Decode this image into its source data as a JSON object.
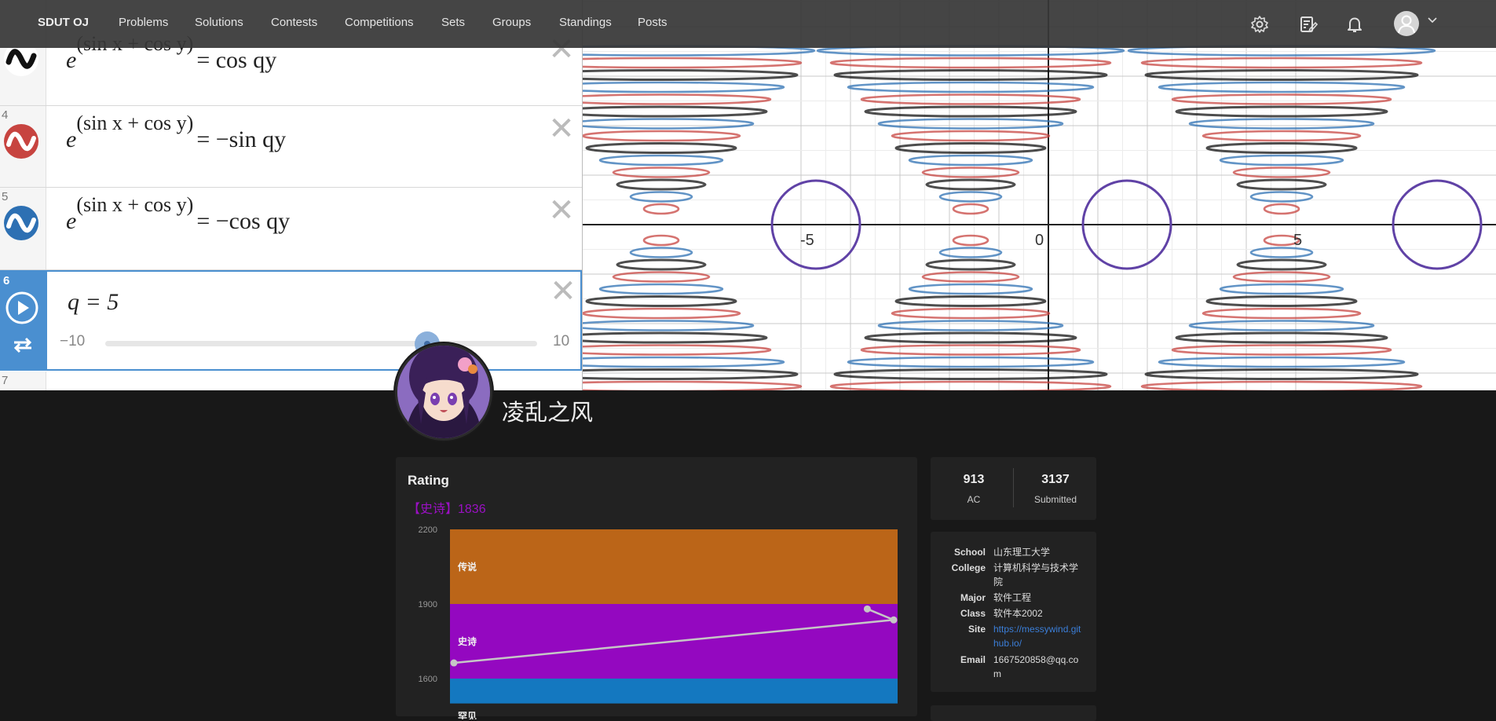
{
  "navbar": {
    "brand": "SDUT OJ",
    "items": [
      "Problems",
      "Solutions",
      "Contests",
      "Competitions",
      "Sets",
      "Groups",
      "Standings",
      "Posts"
    ]
  },
  "banner": {
    "expressions": [
      {
        "number": "",
        "lhs": "e",
        "exponent": "(sin x + cos y)",
        "rhs": "= cos qy",
        "icon_color": "#111111"
      },
      {
        "number": "4",
        "lhs": "e",
        "exponent": "(sin x + cos y)",
        "rhs": "= −sin qy",
        "icon_color": "#c74440"
      },
      {
        "number": "5",
        "lhs": "e",
        "exponent": "(sin x + cos y)",
        "rhs": "= −cos qy",
        "icon_color": "#2d70b3"
      }
    ],
    "slider": {
      "number": "6",
      "label": "q = 5",
      "min": "−10",
      "max": "10",
      "value": 5
    },
    "next_row_number": "7",
    "graph_ticks": [
      "-5",
      "0",
      "5"
    ],
    "colors": {
      "red": "#c74440",
      "blue": "#2d70b3",
      "black": "#111111",
      "purple": "#6042a6"
    }
  },
  "profile": {
    "username": "凌乱之风"
  },
  "rating": {
    "title": "Rating",
    "current": "【史诗】1836",
    "y_ticks": [
      "2200",
      "1900",
      "1600"
    ],
    "bands": [
      {
        "name": "传说",
        "color": "#bb6518"
      },
      {
        "name": "史诗",
        "color": "#9408c0"
      },
      {
        "name": "罕见",
        "color": "#1478c0"
      }
    ]
  },
  "chart_data": {
    "type": "line",
    "title": "Rating",
    "y_range": [
      1500,
      2200
    ],
    "bands": [
      {
        "label": "传说",
        "from": 1900,
        "to": 2200,
        "color": "#bb6518"
      },
      {
        "label": "史诗",
        "from": 1600,
        "to": 1900,
        "color": "#9408c0"
      },
      {
        "label": "罕见",
        "from": 1500,
        "to": 1600,
        "color": "#1478c0"
      }
    ],
    "series": [
      {
        "values": [
          1663,
          1836,
          1880
        ],
        "order": [
          0,
          2,
          1
        ]
      }
    ],
    "points": [
      {
        "x": 0,
        "y": 1663
      },
      {
        "x": 1,
        "y": 1836
      },
      {
        "x": 0.94,
        "y": 1880
      }
    ]
  },
  "stats": {
    "ac_value": "913",
    "ac_label": "AC",
    "submitted_value": "3137",
    "submitted_label": "Submitted"
  },
  "info": {
    "school_label": "School",
    "school": "山东理工大学",
    "college_label": "College",
    "college": "计算机科学与技术学院",
    "major_label": "Major",
    "major": "软件工程",
    "class_label": "Class",
    "class": "软件本2002",
    "site_label": "Site",
    "site": "https://messywind.github.io/",
    "email_label": "Email",
    "email": "1667520858@qq.com"
  }
}
